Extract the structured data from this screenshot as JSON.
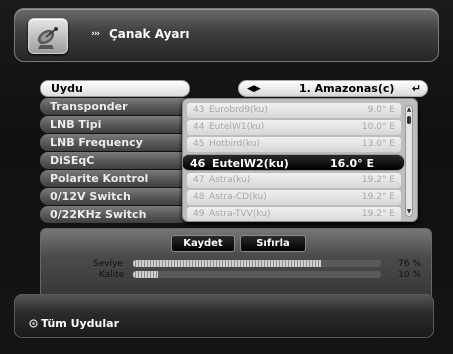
{
  "header": {
    "title": "Çanak Ayarı",
    "arrows": "›››",
    "logo_icon": "satellite-dish-icon"
  },
  "settings": [
    {
      "label": "Uydu",
      "active": true
    },
    {
      "label": "Transponder"
    },
    {
      "label": "LNB Tipi"
    },
    {
      "label": "LNB Frequency"
    },
    {
      "label": "DiSEqC"
    },
    {
      "label": "Polarite Kontrol"
    },
    {
      "label": "0/12V Switch"
    },
    {
      "label": "0/22KHz Switch"
    }
  ],
  "uydu_value": {
    "text": "1. Amazonas(c)",
    "left_right_icon": "◀▶",
    "enter_icon": "↵"
  },
  "satellite_list": [
    {
      "num": "43",
      "name": "Eurobrd9(ku)",
      "deg": "9.0° E"
    },
    {
      "num": "44",
      "name": "EutelW1(ku)",
      "deg": "10.0° E"
    },
    {
      "num": "45",
      "name": "Hotbird(ku)",
      "deg": "13.0° E"
    },
    {
      "num": "46",
      "name": "EutelW2(ku)",
      "deg": "16.0° E",
      "selected": true
    },
    {
      "num": "47",
      "name": "Astra(ku)",
      "deg": "19.2° E"
    },
    {
      "num": "48",
      "name": "Astra-CD(ku)",
      "deg": "19.2° E"
    },
    {
      "num": "49",
      "name": "Astra-TVV(ku)",
      "deg": "19.2° E"
    }
  ],
  "buttons": {
    "save": "Kaydet",
    "reset": "Sıfırla"
  },
  "signal": {
    "seviye_label": "Seviye",
    "seviye_pct": "76 %",
    "seviye_value": 76,
    "kalite_label": "Kalite",
    "kalite_pct": "10 %",
    "kalite_value": 10
  },
  "footer": {
    "text": "Tüm Uydular"
  }
}
